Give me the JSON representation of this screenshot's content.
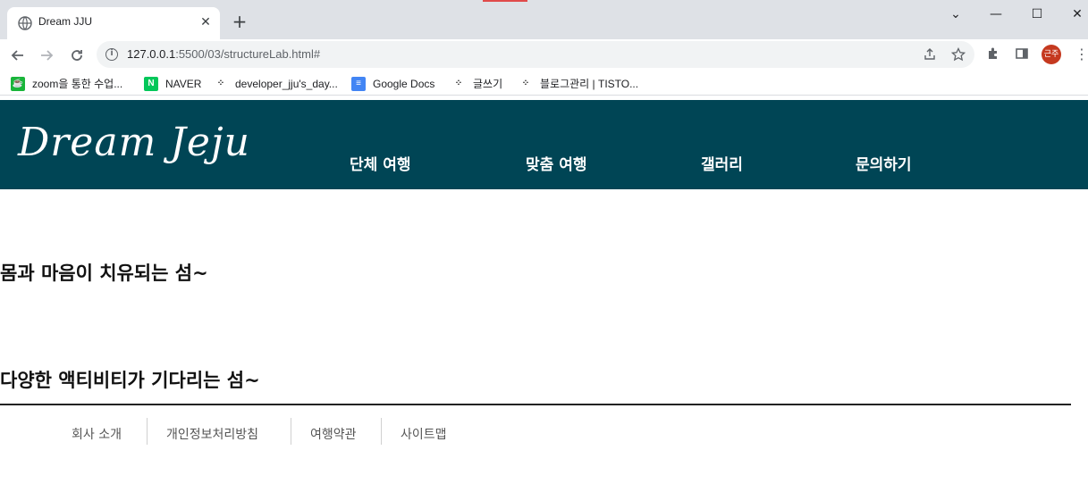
{
  "browser": {
    "tab_title": "Dream JJU",
    "tab_close": "✕",
    "new_tab": "+",
    "window_controls": {
      "chevron": "⌄",
      "minimize": "—",
      "maximize": "☐",
      "close": "✕"
    },
    "url_host": "127.0.0.1",
    "url_path": ":5500/03/structureLab.html#",
    "profile_initials": "근주",
    "bookmarks": [
      {
        "label": "zoom을 통한 수업...",
        "icon": "zoom-icon",
        "color": "#19b53a"
      },
      {
        "label": "NAVER",
        "icon": "naver-icon",
        "color": "#03c75a"
      },
      {
        "label": "developer_jju's_day...",
        "icon": "tistory-icon",
        "color": "#222222"
      },
      {
        "label": "Google Docs",
        "icon": "google-docs-icon",
        "color": "#4285f4"
      },
      {
        "label": "글쓰기",
        "icon": "tistory-icon",
        "color": "#222222"
      },
      {
        "label": "블로그관리 | TISTO...",
        "icon": "tistory-icon",
        "color": "#222222"
      }
    ]
  },
  "page": {
    "header_bg": "#004555",
    "logo": "Dream Jeju",
    "nav": [
      "단체 여행",
      "맞춤 여행",
      "갤러리",
      "문의하기"
    ],
    "sections": [
      "몸과 마음이 치유되는 섬~",
      "다양한 액티비티가 기다리는 섬~"
    ],
    "footer_links": [
      "회사 소개",
      "개인정보처리방침",
      "여행약관",
      "사이트맵"
    ]
  }
}
